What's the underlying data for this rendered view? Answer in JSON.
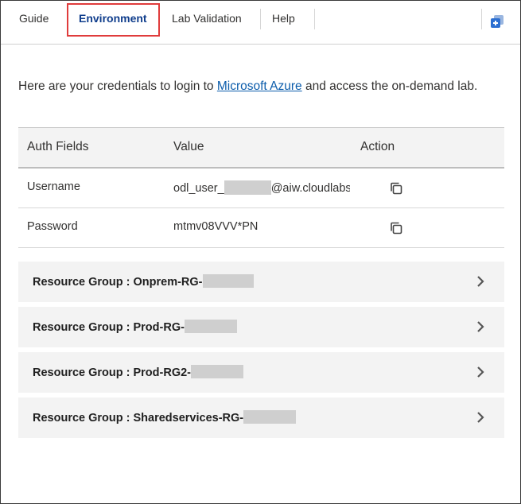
{
  "tabs": [
    {
      "label": "Guide",
      "active": false
    },
    {
      "label": "Environment",
      "active": true
    },
    {
      "label": "Lab Validation",
      "active": false
    },
    {
      "label": "Help",
      "active": false
    }
  ],
  "intro": {
    "prefix": "Here are your credentials to login to ",
    "link": "Microsoft Azure",
    "suffix": " and access the on-demand lab."
  },
  "table": {
    "headers": [
      "Auth Fields",
      "Value",
      "Action"
    ],
    "rows": [
      {
        "field": "Username",
        "value_prefix": "odl_user_",
        "value_suffix": "@aiw.cloudlabs.ai",
        "redacted": true
      },
      {
        "field": "Password",
        "value_prefix": "mtmv08VVV*PN",
        "value_suffix": "",
        "redacted": false
      }
    ]
  },
  "resource_groups": [
    {
      "label": "Resource Group : Onprem-RG-"
    },
    {
      "label": "Resource Group : Prod-RG-"
    },
    {
      "label": "Resource Group : Prod-RG2-"
    },
    {
      "label": "Resource Group : Sharedservices-RG-"
    }
  ],
  "icons": {
    "copy": "copy-icon",
    "chevron": "chevron-right-icon",
    "popout": "popout-window-icon"
  },
  "colors": {
    "active_tab": "#0f3d8c",
    "highlight": "#e03c3c",
    "link": "#0b5cab",
    "panel_bg": "#f3f3f3"
  }
}
